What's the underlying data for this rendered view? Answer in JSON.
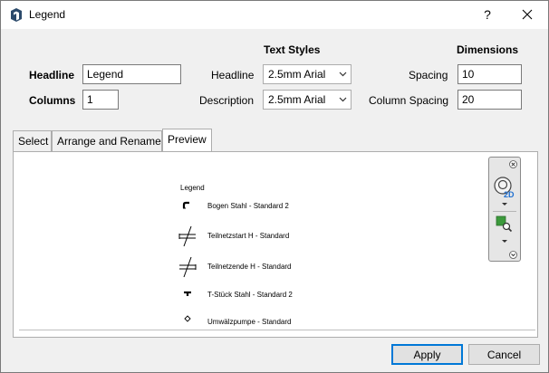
{
  "window": {
    "title": "Legend",
    "help_label": "?"
  },
  "form": {
    "headline_label": "Headline",
    "headline_value": "Legend",
    "columns_label": "Columns",
    "columns_value": "1",
    "text_styles_heading": "Text Styles",
    "style_headline_label": "Headline",
    "style_headline_value": "2.5mm Arial",
    "style_description_label": "Description",
    "style_description_value": "2.5mm Arial",
    "dimensions_heading": "Dimensions",
    "spacing_label": "Spacing",
    "spacing_value": "10",
    "column_spacing_label": "Column Spacing",
    "column_spacing_value": "20"
  },
  "tabs": [
    {
      "label": "Select",
      "active": false
    },
    {
      "label": "Arrange and Rename",
      "active": false
    },
    {
      "label": "Preview",
      "active": true
    }
  ],
  "preview": {
    "legend_title": "Legend",
    "items": [
      {
        "label": "Bogen Stahl - Standard 2",
        "icon": "bend-fitting-icon"
      },
      {
        "label": "Teilnetzstart H - Standard",
        "icon": "subnet-start-icon"
      },
      {
        "label": "Teilnetzende H - Standard",
        "icon": "subnet-end-icon"
      },
      {
        "label": "T-Stück Stahl - Standard 2",
        "icon": "tee-fitting-icon"
      },
      {
        "label": "Umwälzpumpe - Standard",
        "icon": "pump-icon"
      }
    ]
  },
  "buttons": {
    "apply_label": "Apply",
    "cancel_label": "Cancel"
  },
  "colors": {
    "accent": "#0078d7",
    "nav_2d_blue": "#1f6fd0",
    "zoom_green": "#3c9a3c"
  }
}
